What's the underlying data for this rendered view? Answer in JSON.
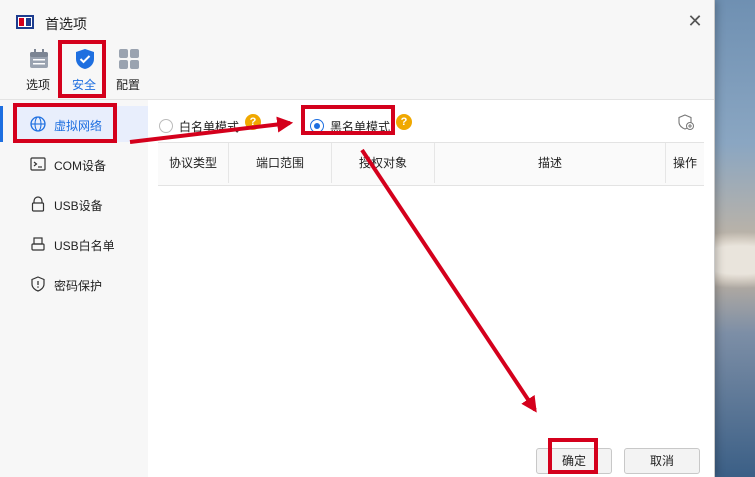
{
  "window": {
    "title": "首选项"
  },
  "toolbar": {
    "items": [
      {
        "label": "选项",
        "icon": "calendar-icon"
      },
      {
        "label": "安全",
        "icon": "shield-check-icon",
        "active": true
      },
      {
        "label": "配置",
        "icon": "grid-settings-icon"
      }
    ]
  },
  "sidebar": {
    "items": [
      {
        "label": "虚拟网络",
        "icon": "globe-icon",
        "active": true
      },
      {
        "label": "COM设备",
        "icon": "terminal-icon"
      },
      {
        "label": "USB设备",
        "icon": "usb-lock-icon"
      },
      {
        "label": "USB白名单",
        "icon": "usb-drive-icon"
      },
      {
        "label": "密码保护",
        "icon": "shield-icon"
      }
    ]
  },
  "mode": {
    "whitelist_label": "白名单模式",
    "blacklist_label": "黑名单模式",
    "selected": "黑名单模式"
  },
  "table": {
    "columns": [
      "协议类型",
      "端口范围",
      "授权对象",
      "描述",
      "操作"
    ],
    "rows": []
  },
  "buttons": {
    "ok": "确定",
    "cancel": "取消"
  },
  "colors": {
    "accent": "#1e6fe0",
    "annotation": "#d4001c",
    "help": "#f0a800"
  }
}
